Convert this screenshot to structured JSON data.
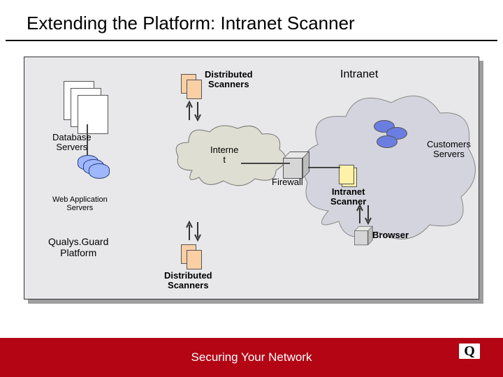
{
  "title": "Extending the Platform: Intranet Scanner",
  "footer": "Securing Your Network",
  "logo": {
    "glyph": "Q",
    "brand": "qualys"
  },
  "labels": {
    "distributed_top": "Distributed\nScanners",
    "distributed_bottom": "Distributed\nScanners",
    "intranet": "Intranet",
    "database_servers": "Database\nServers",
    "internet": "Interne\nt",
    "customers_servers": "Customers\nServers",
    "firewall": "Firewall",
    "intranet_scanner": "Intranet\nScanner",
    "web_app_servers": "Web Application\nServers",
    "browser": "Browser",
    "qualys_platform": "Qualys.Guard\nPlatform"
  }
}
